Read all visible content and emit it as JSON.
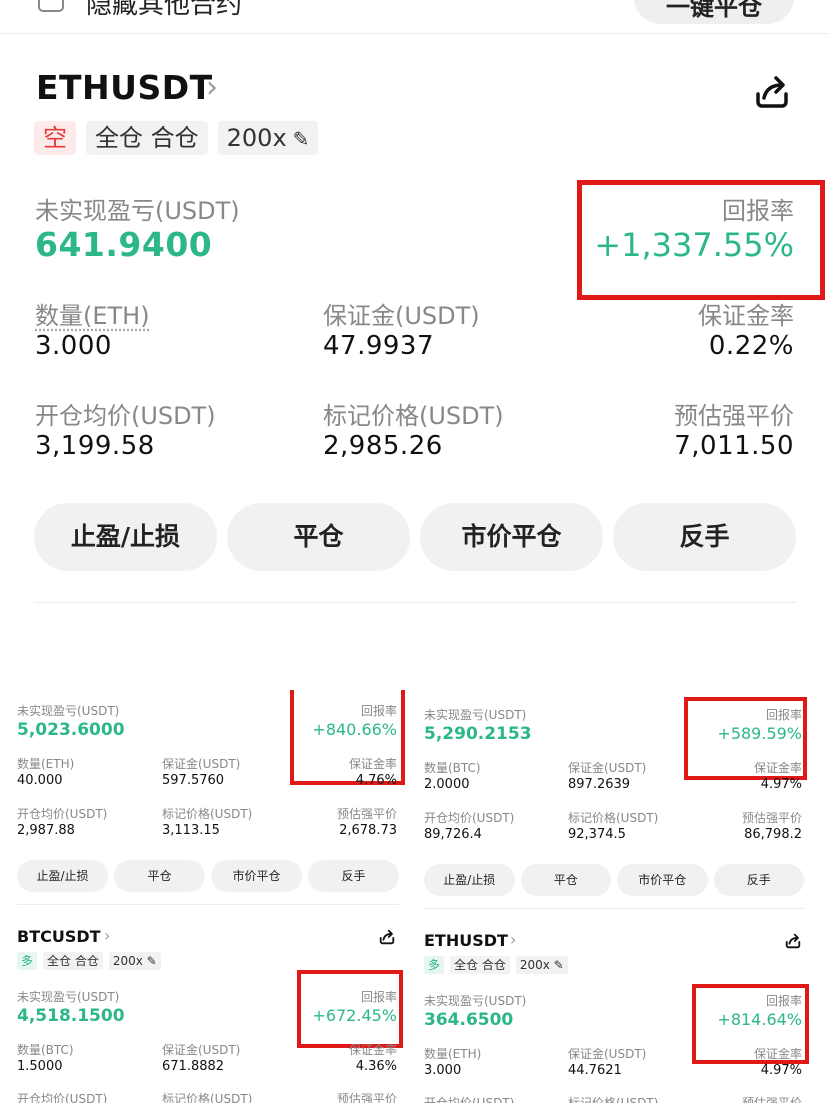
{
  "top": {
    "checkbox_label": "隐藏其他合约",
    "button_label": "一键平仓"
  },
  "main": {
    "symbol": "ETHUSDT",
    "chevron": "›",
    "tags": {
      "side": "空",
      "margin_mode": "全仓 合仓",
      "leverage": "200x",
      "edit_icon": "✎"
    },
    "unrealized_label": "未实现盈亏(USDT)",
    "unrealized_value": "641.9400",
    "roi_label": "回报率",
    "roi_value": "+1,337.55%",
    "qty_label": "数量(ETH)",
    "qty_value": "3.000",
    "margin_label": "保证金(USDT)",
    "margin_value": "47.9937",
    "margin_rate_label": "保证金率",
    "margin_rate_value": "0.22%",
    "entry_label": "开仓均价(USDT)",
    "entry_value": "3,199.58",
    "mark_label": "标记价格(USDT)",
    "mark_value": "2,985.26",
    "liq_label": "预估强平价",
    "liq_value": "7,011.50",
    "buttons": [
      "止盈/止损",
      "平仓",
      "市价平仓",
      "反手"
    ]
  },
  "card_a": {
    "unrealized_label": "未实现盈亏(USDT)",
    "unrealized_value": "5,023.6000",
    "roi_label": "回报率",
    "roi_value": "+840.66%",
    "qty_label": "数量(ETH)",
    "qty_value": "40.000",
    "margin_label": "保证金(USDT)",
    "margin_value": "597.5760",
    "margin_rate_label": "保证金率",
    "margin_rate_value": "4.76%",
    "entry_label": "开仓均价(USDT)",
    "entry_value": "2,987.88",
    "mark_label": "标记价格(USDT)",
    "mark_value": "3,113.15",
    "liq_label": "预估强平价",
    "liq_value": "2,678.73",
    "buttons": [
      "止盈/止损",
      "平仓",
      "市价平仓",
      "反手"
    ]
  },
  "card_b": {
    "unrealized_label": "未实现盈亏(USDT)",
    "unrealized_value": "5,290.2153",
    "roi_label": "回报率",
    "roi_value": "+589.59%",
    "qty_label": "数量(BTC)",
    "qty_value": "2.0000",
    "margin_label": "保证金(USDT)",
    "margin_value": "897.2639",
    "margin_rate_label": "保证金率",
    "margin_rate_value": "4.97%",
    "entry_label": "开仓均价(USDT)",
    "entry_value": "89,726.4",
    "mark_label": "标记价格(USDT)",
    "mark_value": "92,374.5",
    "liq_label": "预估强平价",
    "liq_value": "86,798.2",
    "buttons": [
      "止盈/止损",
      "平仓",
      "市价平仓",
      "反手"
    ]
  },
  "card_c": {
    "symbol": "BTCUSDT",
    "chevron": "›",
    "tags": {
      "side": "多",
      "margin_mode": "全仓 合仓",
      "leverage": "200x ✎"
    },
    "unrealized_label": "未实现盈亏(USDT)",
    "unrealized_value": "4,518.1500",
    "roi_label": "回报率",
    "roi_value": "+672.45%",
    "qty_label": "数量(BTC)",
    "qty_value": "1.5000",
    "margin_label": "保证金(USDT)",
    "margin_value": "671.8882",
    "margin_rate_label": "保证金率",
    "margin_rate_value": "4.36%",
    "entry_label": "开仓均价(USDT)",
    "mark_label": "标记价格(USDT)",
    "liq_label": "预估强平价"
  },
  "card_d": {
    "symbol": "ETHUSDT",
    "chevron": "›",
    "tags": {
      "side": "多",
      "margin_mode": "全仓 合仓",
      "leverage": "200x ✎"
    },
    "unrealized_label": "未实现盈亏(USDT)",
    "unrealized_value": "364.6500",
    "roi_label": "回报率",
    "roi_value": "+814.64%",
    "qty_label": "数量(ETH)",
    "qty_value": "3.000",
    "margin_label": "保证金(USDT)",
    "margin_value": "44.7621",
    "margin_rate_label": "保证金率",
    "margin_rate_value": "4.97%",
    "entry_label": "开仓均价(USDT)",
    "mark_label": "标记价格(USDT)",
    "liq_label": "预估强平价"
  },
  "colors": {
    "profit_green": "#2bb886",
    "short_red": "#e23b3b",
    "highlight_box": "#e01818"
  }
}
